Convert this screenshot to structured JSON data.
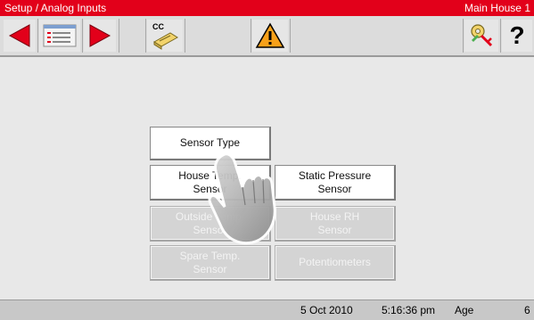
{
  "title_bar": {
    "title": "Setup / Analog Inputs",
    "location": "Main House 1",
    "color": "#e2001a"
  },
  "toolbar": {
    "back_icon": "triangle-left-icon",
    "menu_icon": "menu-list-icon",
    "forward_icon": "triangle-right-icon",
    "cc_label": "CC",
    "cc_icon": "cc-card-icon",
    "alarm_icon": "warning-icon",
    "key_icon": "key-icon",
    "help_label": "?"
  },
  "main": {
    "buttons": [
      {
        "label": "Sensor Type",
        "enabled": true
      },
      {
        "label": "House Temp.\nSensor",
        "enabled": true
      },
      {
        "label": "Static Pressure\nSensor",
        "enabled": true
      },
      {
        "label": "Outside Temp.\nSensor",
        "enabled": false
      },
      {
        "label": "House RH\nSensor",
        "enabled": false
      },
      {
        "label": "Spare Temp.\nSensor",
        "enabled": false
      },
      {
        "label": "Potentiometers",
        "enabled": false
      }
    ]
  },
  "status_bar": {
    "date": "5 Oct 2010",
    "time": "5:16:36 pm",
    "age_label": "Age",
    "age_value": "6"
  }
}
